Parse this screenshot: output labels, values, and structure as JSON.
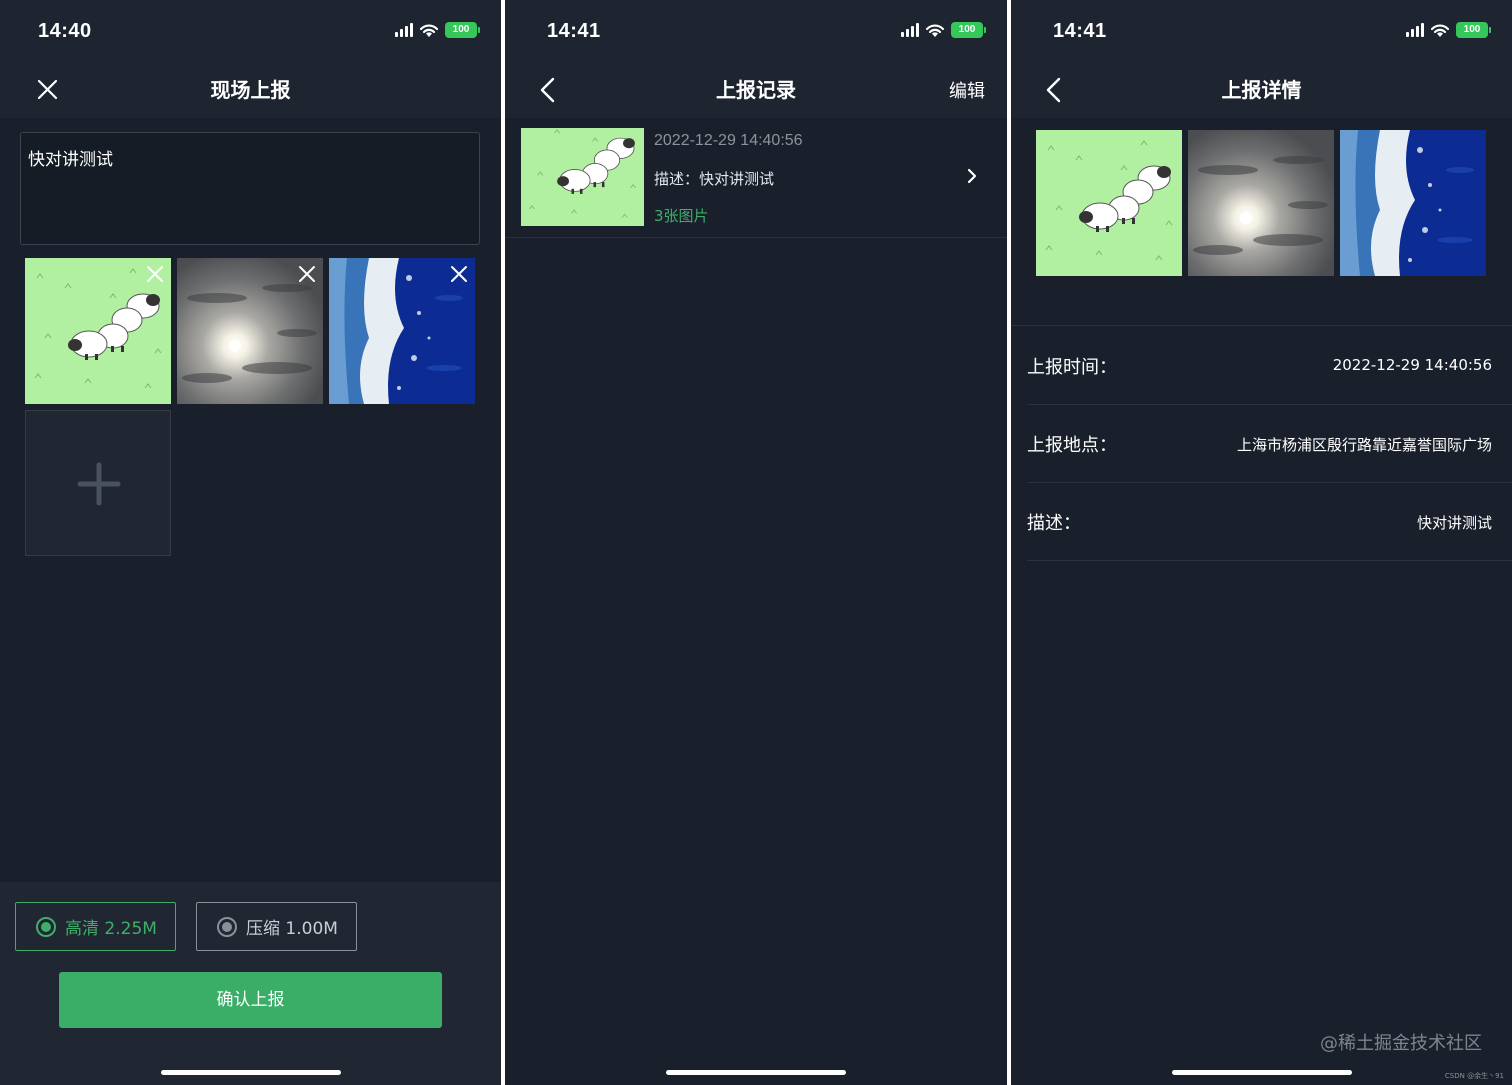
{
  "status_bar": {
    "battery": "100",
    "screens": [
      "14:40",
      "14:41",
      "14:41"
    ]
  },
  "report_screen": {
    "title": "现场上报",
    "close_icon": "close-icon",
    "description": "快对讲测试",
    "images": [
      {
        "type": "sheep-cartoon"
      },
      {
        "type": "cloudy-sun"
      },
      {
        "type": "ocean-waves"
      }
    ],
    "add_icon": "plus-icon",
    "quality_options": [
      {
        "label": "高清 2.25M",
        "selected": true
      },
      {
        "label": "压缩 1.00M",
        "selected": false
      }
    ],
    "confirm_label": "确认上报",
    "accent_color": "#3aad66"
  },
  "records_screen": {
    "title": "上报记录",
    "edit_label": "编辑",
    "back_icon": "back-chevron-icon",
    "records": [
      {
        "datetime": "2022-12-29 14:40:56",
        "description": "描述：快对讲测试",
        "image_count": "3张图片"
      }
    ]
  },
  "detail_screen": {
    "title": "上报详情",
    "back_icon": "back-chevron-icon",
    "fields": [
      {
        "label": "上报时间：",
        "value": "2022-12-29 14:40:56"
      },
      {
        "label": "上报地点：",
        "value": "上海市杨浦区殷行路靠近嘉誉国际广场"
      },
      {
        "label": "描述：",
        "value": "快对讲测试"
      }
    ]
  },
  "watermark": "@稀土掘金技术社区",
  "watermark_small": "CSDN @余生丶91"
}
